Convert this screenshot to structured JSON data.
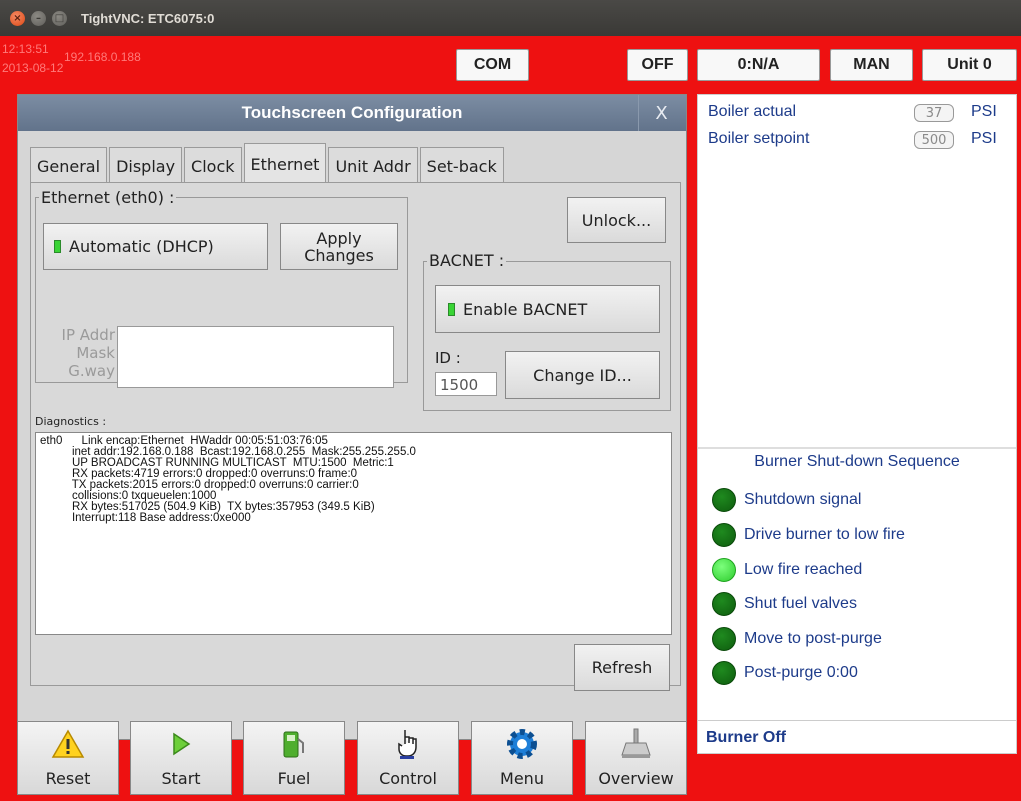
{
  "window": {
    "title": "TightVNC: ETC6075:0"
  },
  "header": {
    "time": "12:13:51",
    "date": "2013-08-12",
    "ip": "192.168.0.188",
    "buttons": {
      "com": "COM",
      "off": "OFF",
      "na": "0:N/A",
      "man": "MAN",
      "unit": "Unit 0"
    }
  },
  "dialog": {
    "title": "Touchscreen Configuration",
    "close": "X",
    "tabs": [
      "General",
      "Display",
      "Clock",
      "Ethernet",
      "Unit Addr",
      "Set-back"
    ],
    "active_tab": "Ethernet",
    "ethernet_group": "Ethernet (eth0) :",
    "dhcp_button": "Automatic (DHCP)",
    "apply_button_line1": "Apply",
    "apply_button_line2": "Changes",
    "unlock_button": "Unlock...",
    "bacnet_group": "BACNET :",
    "enable_bacnet_button": "Enable BACNET",
    "id_label": "ID :",
    "id_value": "1500",
    "change_id_button": "Change ID...",
    "ip_addr_label": "IP Addr",
    "mask_label": "Mask",
    "gway_label": "G.way",
    "diagnostics_label": "Diagnostics :",
    "diagnostics_text": "eth0      Link encap:Ethernet  HWaddr 00:05:51:03:76:05\n          inet addr:192.168.0.188  Bcast:192.168.0.255  Mask:255.255.255.0\n          UP BROADCAST RUNNING MULTICAST  MTU:1500  Metric:1\n          RX packets:4719 errors:0 dropped:0 overruns:0 frame:0\n          TX packets:2015 errors:0 dropped:0 overruns:0 carrier:0\n          collisions:0 txqueuelen:1000\n          RX bytes:517025 (504.9 KiB)  TX bytes:357953 (349.5 KiB)\n          Interrupt:118 Base address:0xe000",
    "refresh_button": "Refresh"
  },
  "status_panel": {
    "boiler_actual_label": "Boiler actual",
    "boiler_actual_value": "37",
    "boiler_actual_unit": "PSI",
    "boiler_setpoint_label": "Boiler setpoint",
    "boiler_setpoint_value": "500",
    "boiler_setpoint_unit": "PSI",
    "sequence_title": "Burner Shut-down Sequence",
    "sequence": [
      {
        "label": "Shutdown signal",
        "lit": false
      },
      {
        "label": "Drive burner to low fire",
        "lit": false
      },
      {
        "label": "Low fire reached",
        "lit": true
      },
      {
        "label": "Shut fuel valves",
        "lit": false
      },
      {
        "label": "Move to post-purge",
        "lit": false
      },
      {
        "label": "Post-purge 0:00",
        "lit": false
      }
    ],
    "status_text": "Burner Off"
  },
  "nav": [
    {
      "label": "Reset",
      "icon": "warning-icon"
    },
    {
      "label": "Start",
      "icon": "play-icon"
    },
    {
      "label": "Fuel",
      "icon": "fuel-pump-icon"
    },
    {
      "label": "Control",
      "icon": "hand-pointer-icon"
    },
    {
      "label": "Menu",
      "icon": "gear-icon"
    },
    {
      "label": "Overview",
      "icon": "valve-icon"
    }
  ],
  "colors": {
    "background": "#ee1111",
    "accent_text": "#1d3b8a",
    "led_on": "#39d435",
    "title_bar": "#62738b"
  }
}
